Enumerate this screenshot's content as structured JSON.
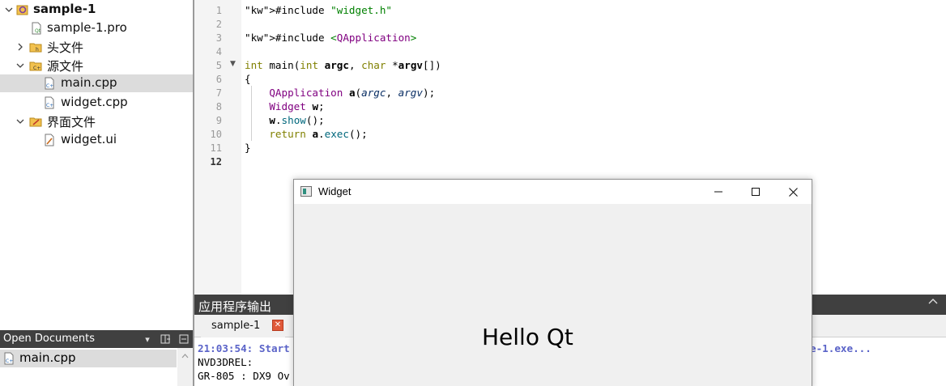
{
  "project_tree": {
    "project_name": "sample-1",
    "items": [
      {
        "label": "sample-1.pro",
        "icon": "qt-project-file-icon"
      },
      {
        "label": "头文件",
        "icon": "header-folder-icon",
        "expanded": false
      },
      {
        "label": "源文件",
        "icon": "source-folder-icon",
        "expanded": true
      },
      {
        "label": "main.cpp",
        "icon": "cpp-file-icon",
        "selected": true
      },
      {
        "label": "widget.cpp",
        "icon": "cpp-file-icon"
      },
      {
        "label": "界面文件",
        "icon": "forms-folder-icon",
        "expanded": true
      },
      {
        "label": "widget.ui",
        "icon": "ui-file-icon"
      }
    ]
  },
  "open_documents": {
    "title": "Open Documents",
    "items": [
      "main.cpp"
    ]
  },
  "editor": {
    "line_numbers": [
      "1",
      "2",
      "3",
      "4",
      "5",
      "6",
      "7",
      "8",
      "9",
      "10",
      "11",
      "12"
    ],
    "current_line": "12",
    "lines": [
      "#include \"widget.h\"",
      "",
      "#include <QApplication>",
      "",
      "int main(int argc, char *argv[])",
      "{",
      "    QApplication a(argc, argv);",
      "    Widget w;",
      "    w.show();",
      "    return a.exec();",
      "}",
      ""
    ]
  },
  "output": {
    "title": "应用程序输出",
    "tab_label": "sample-1",
    "lines": [
      "21:03:54: Start",
      "NVD3DREL:",
      "GR-805 : DX9 Ov"
    ],
    "line_right": "e-1.exe..."
  },
  "widget_window": {
    "title": "Widget",
    "label": "Hello Qt"
  },
  "colors": {
    "panel_header": "#404040",
    "selection": "#dcdcdc",
    "keyword": "#808000",
    "string": "#008000",
    "type": "#800080",
    "output_blue": "#5a63c8"
  }
}
